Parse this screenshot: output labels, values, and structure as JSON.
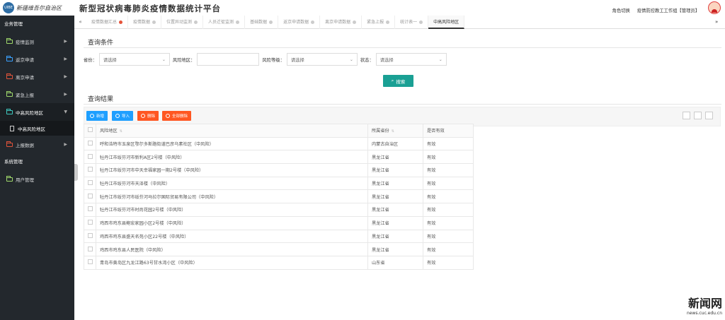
{
  "header": {
    "logo_text": "新疆维吾尔自治区",
    "title": "新型冠状病毒肺炎疫情数据统计平台",
    "role_switch": "角色切换",
    "user": "疫情防控教工工作组【管理员】"
  },
  "sidebar": {
    "section1": "业务管理",
    "items": [
      {
        "label": "疫情监测",
        "color": "#9fd86b"
      },
      {
        "label": "返京申请",
        "color": "#3aa1ff"
      },
      {
        "label": "离京申请",
        "color": "#e0533a"
      },
      {
        "label": "紧急上报",
        "color": "#9fd86b"
      },
      {
        "label": "中高风险地区",
        "color": "#3ec9c0"
      }
    ],
    "sub_item": "中高风险地区",
    "item_after": {
      "label": "上报数据",
      "color": "#e0533a"
    },
    "section2": "系统管理",
    "sys_item": {
      "label": "用户管理",
      "color": "#9fd86b"
    }
  },
  "tabs": [
    "疫情数据汇总",
    "疫情数据",
    "位置异动监测",
    "人员迁徙监测",
    "基础数据",
    "返京申请数据",
    "离京申请数据",
    "紧急上报",
    "统计表一",
    "中高风险地区"
  ],
  "query": {
    "title": "查询条件",
    "province_label": "省份：",
    "province_value": "请选择",
    "area_label": "风险地区：",
    "level_label": "风险等级：",
    "level_value": "请选择",
    "status_label": "状态：",
    "status_value": "请选择",
    "search_label": "搜索"
  },
  "results": {
    "title": "查询结果",
    "buttons": {
      "add": "新增",
      "import": "导入",
      "delete": "删除",
      "delete_all": "全部删除"
    },
    "columns": [
      "风险地区",
      "所属省份",
      "是否有效"
    ],
    "rows": [
      [
        "呼和浩特市玉泉区鄂尔多斯路街道巴彦乌素社区（中风险）",
        "内蒙古自治区",
        "有效"
      ],
      [
        "牡丹江市绥芬河市新利A区2号楼（中风险）",
        "黑龙江省",
        "有效"
      ],
      [
        "牡丹江市绥芬河市中天幸福家园一期2号楼（中风险）",
        "黑龙江省",
        "有效"
      ],
      [
        "牡丹江市绥芬河市天泽楼（中风险）",
        "黑龙江省",
        "有效"
      ],
      [
        "牡丹江市绥芬河市绥芬河马拉尔国际贸易有限公司（中风险）",
        "黑龙江省",
        "有效"
      ],
      [
        "牡丹江市绥芬河市时尚花园2号楼（中风险）",
        "黑龙江省",
        "有效"
      ],
      [
        "鸡西市鸡东县鲍宏家园小区2号楼（中风险）",
        "黑龙江省",
        "有效"
      ],
      [
        "鸡西市鸡东县盛天名苑小区22号楼（中风险）",
        "黑龙江省",
        "有效"
      ],
      [
        "鸡西市鸡东县人民医院（中风险）",
        "黑龙江省",
        "有效"
      ],
      [
        "青岛市黄岛区九龙江路63号甘水湾小区（中风险）",
        "山东省",
        "有效"
      ]
    ]
  },
  "watermark": {
    "big": "新闻网",
    "small": "news.cuc.edu.cn"
  }
}
